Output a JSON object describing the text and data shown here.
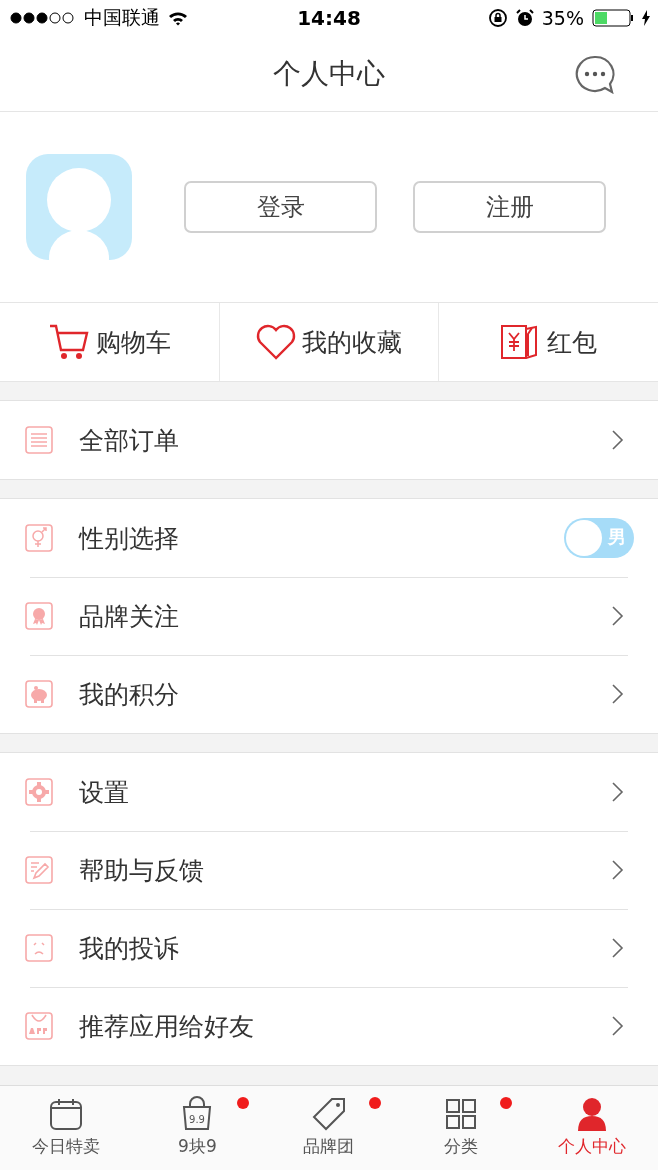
{
  "status_bar": {
    "carrier": "中国联通",
    "time": "14:48",
    "battery": "35%"
  },
  "nav": {
    "title": "个人中心"
  },
  "profile": {
    "buttons": [
      "登录",
      "注册"
    ]
  },
  "shortcuts": [
    {
      "kind": "cart",
      "label": "购物车"
    },
    {
      "kind": "heart",
      "label": "我的收藏"
    },
    {
      "kind": "redpacket",
      "label": "红包"
    }
  ],
  "groups": [
    [
      {
        "kind": "list",
        "label": "全部订单"
      }
    ],
    [
      {
        "kind": "gender",
        "label": "性别选择",
        "on": false,
        "value": "男"
      },
      {
        "kind": "medal",
        "label": "品牌关注"
      },
      {
        "kind": "piggy",
        "label": "我的积分"
      }
    ],
    [
      {
        "kind": "gear",
        "label": "设置"
      },
      {
        "kind": "pencil",
        "label": "帮助与反馈"
      },
      {
        "kind": "sad",
        "label": "我的投诉"
      },
      {
        "kind": "app",
        "label": "推荐应用给好友"
      }
    ]
  ],
  "tabbar": [
    {
      "kind": "calendar",
      "label": "今日特卖",
      "selected": false,
      "dot": false
    },
    {
      "kind": "bag",
      "icon_text": "9.9",
      "label": "9块9",
      "selected": false,
      "dot": true
    },
    {
      "kind": "tag",
      "label": "品牌团",
      "selected": false,
      "dot": true
    },
    {
      "kind": "grid",
      "label": "分类",
      "selected": false,
      "dot": true
    },
    {
      "kind": "person",
      "label": "个人中心",
      "selected": true,
      "dot": false
    }
  ]
}
